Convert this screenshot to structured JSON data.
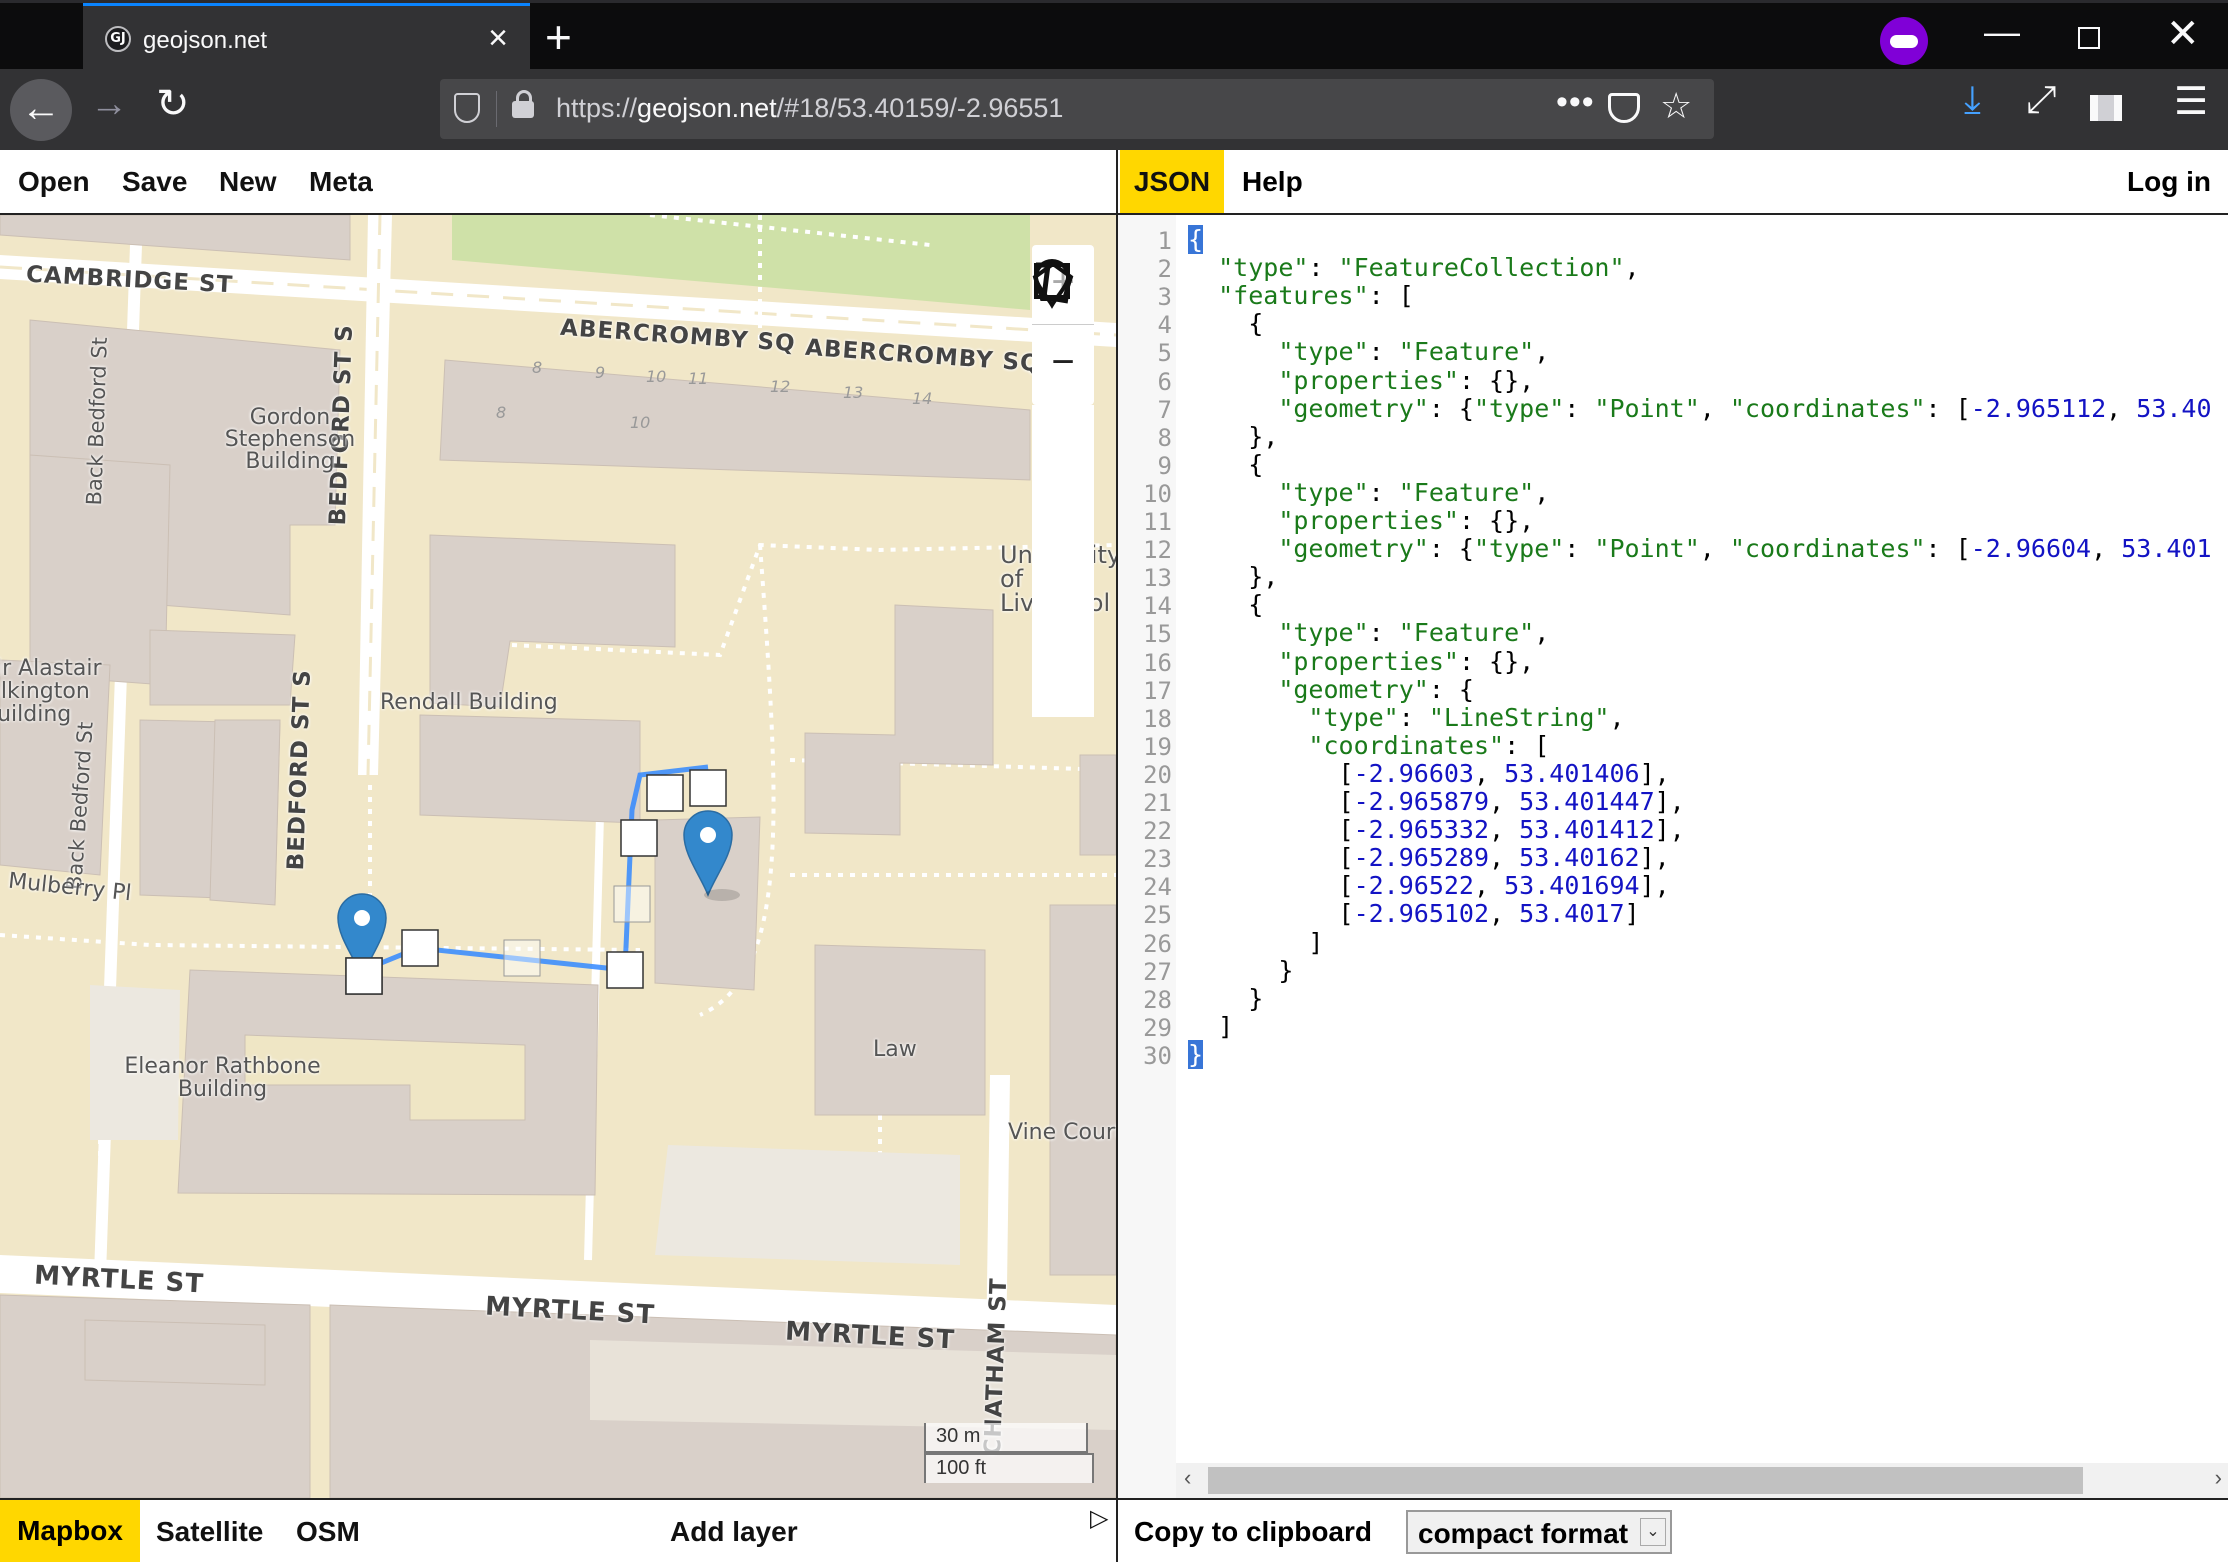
{
  "browser": {
    "tab_title": "geojson.net",
    "favicon_text": "GJ",
    "url_prefix": "https://",
    "url_domain": "geojson.net",
    "url_rest": "/#18/53.40159/-2.96551",
    "icons": [
      "back-arrow",
      "forward-arrow",
      "reload",
      "shield",
      "lock",
      "more-dots",
      "pocket",
      "star",
      "download",
      "fullscreen",
      "library",
      "hamburger-menu",
      "private-mask"
    ]
  },
  "app_menu": {
    "open": "Open",
    "save": "Save",
    "new": "New",
    "meta": "Meta"
  },
  "right_menu": {
    "json": "JSON",
    "help": "Help",
    "login": "Log in"
  },
  "map": {
    "streets": {
      "cambridge": "CAMBRIDGE ST",
      "abercromby1": "ABERCROMBY SQ",
      "abercromby2": "ABERCROMBY SQ",
      "bedford1": "BEDFORD ST S",
      "bedford2": "BEDFORD ST S",
      "back_bedford1": "Back Bedford St",
      "back_bedford2": "Back Bedford St",
      "mulberry": "Mulberry Pl",
      "myrtle1": "MYRTLE ST",
      "myrtle2": "MYRTLE ST",
      "myrtle3": "MYRTLE ST",
      "chatham": "CHATHAM ST"
    },
    "buildings": {
      "gordon": "Gordon Stephenson Building",
      "alastair": "Sir Alastair Pilkington Building",
      "rendall": "Rendall Building",
      "eleanor": "Eleanor Rathbone Building",
      "law": "Law",
      "vine": "Vine Court",
      "university": "University of Liverpool"
    },
    "house_numbers": [
      "8",
      "9",
      "10",
      "11",
      "12",
      "13",
      "14",
      "8",
      "10"
    ],
    "controls": {
      "zoom_in": "+",
      "zoom_out": "−"
    },
    "scale": {
      "metric": "30 m",
      "imperial": "100 ft"
    },
    "marker_color": "#3388cc",
    "line_color": "#3388ff"
  },
  "layers": {
    "mapbox": "Mapbox",
    "satellite": "Satellite",
    "osm": "OSM",
    "add_layer": "Add layer",
    "active": "Mapbox",
    "active_color": "#ffd700"
  },
  "editor": {
    "line_numbers": [
      "1",
      "2",
      "3",
      "4",
      "5",
      "6",
      "7",
      "8",
      "9",
      "10",
      "11",
      "12",
      "13",
      "14",
      "15",
      "16",
      "17",
      "18",
      "19",
      "20",
      "21",
      "22",
      "23",
      "24",
      "25",
      "26",
      "27",
      "28",
      "29",
      "30"
    ],
    "l1": "{",
    "l2_key": "\"type\"",
    "l2_val": "\"FeatureCollection\"",
    "l3_key": "\"features\"",
    "l3_rest": ": [",
    "l4": "{",
    "l5_key": "\"type\"",
    "l5_val": "\"Feature\"",
    "l6_key": "\"properties\"",
    "l6_rest": ": {},",
    "l7_key": "\"geometry\"",
    "l7_k2": "\"type\"",
    "l7_v2": "\"Point\"",
    "l7_k3": "\"coordinates\"",
    "l7_n1": "-2.965112",
    "l7_n2": "53.40",
    "l8": "},",
    "l9": "{",
    "l10_key": "\"type\"",
    "l10_val": "\"Feature\"",
    "l11_key": "\"properties\"",
    "l11_rest": ": {},",
    "l12_key": "\"geometry\"",
    "l12_k2": "\"type\"",
    "l12_v2": "\"Point\"",
    "l12_k3": "\"coordinates\"",
    "l12_n1": "-2.96604",
    "l12_n2": "53.401",
    "l13": "},",
    "l14": "{",
    "l15_key": "\"type\"",
    "l15_val": "\"Feature\"",
    "l16_key": "\"properties\"",
    "l16_rest": ": {},",
    "l17_key": "\"geometry\"",
    "l17_rest": ": {",
    "l18_key": "\"type\"",
    "l18_val": "\"LineString\"",
    "l19_key": "\"coordinates\"",
    "l19_rest": ": [",
    "coords": [
      [
        "-2.96603",
        "53.401406"
      ],
      [
        "-2.965879",
        "53.401447"
      ],
      [
        "-2.965332",
        "53.401412"
      ],
      [
        "-2.965289",
        "53.40162"
      ],
      [
        "-2.96522",
        "53.401694"
      ],
      [
        "-2.965102",
        "53.4017"
      ]
    ],
    "l26": "]",
    "l27": "}",
    "l28": "}",
    "l29": "]",
    "l30": "}"
  },
  "footer": {
    "copy": "Copy to clipboard",
    "format": "compact format"
  }
}
